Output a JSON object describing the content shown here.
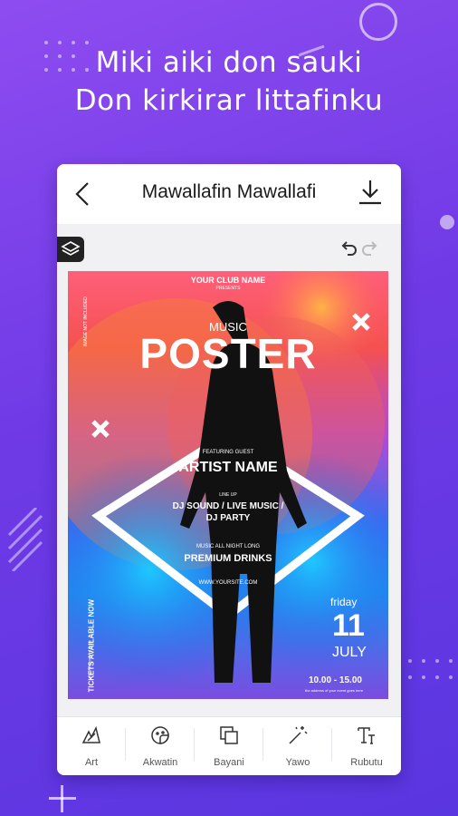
{
  "headline": {
    "line1": "Miki aiki don sauki",
    "line2": "Don kirkirar littafinku"
  },
  "topbar": {
    "title": "Mawallafin Mawallafi"
  },
  "poster": {
    "club": "YOUR CLUB NAME",
    "presents": "PRESENTS",
    "music": "MUSIC",
    "poster": "POSTER",
    "featuring": "FEATURING GUEST",
    "artist": "ARTIST NAME",
    "lineup": "LINE UP",
    "lineup_acts": "DJ SOUND / LIVE MUSIC /",
    "lineup_acts2": "DJ PARTY",
    "music_all_night": "MUSIC ALL NIGHT LONG",
    "drinks": "PREMIUM DRINKS",
    "site": "WWW.YOURSITE.COM",
    "day": "friday",
    "date": "11",
    "month": "JULY",
    "time": "10.00 - 15.00",
    "address": "the address of your event goes here",
    "tickets": "TICKETS AVAILABLE NOW",
    "tickets_site": "WWW.YOURSITE.COM",
    "image_note": "IMAGE NOT INCLUDED"
  },
  "toolbar": {
    "items": [
      {
        "label": "Art",
        "icon": "brush-icon"
      },
      {
        "label": "Akwatin",
        "icon": "sticker-icon"
      },
      {
        "label": "Bayani",
        "icon": "layers-square-icon"
      },
      {
        "label": "Yawo",
        "icon": "magic-wand-icon"
      },
      {
        "label": "Rubutu",
        "icon": "text-icon"
      }
    ]
  },
  "colors": {
    "background": "#6f3ae6",
    "card": "#ffffff"
  }
}
